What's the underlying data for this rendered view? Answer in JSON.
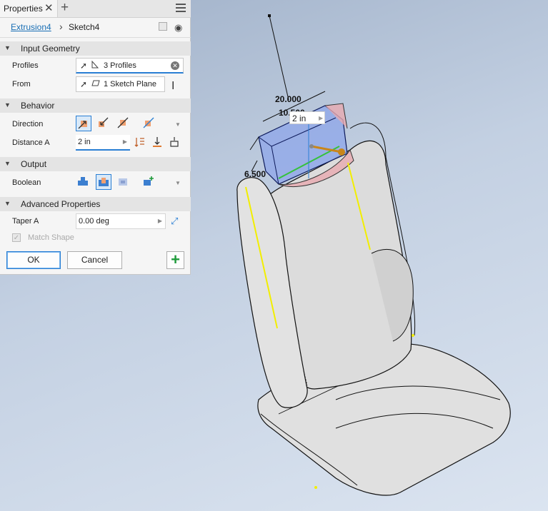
{
  "panel": {
    "tab_label": "Properties",
    "tab_close": "✕",
    "tab_add": "+",
    "breadcrumb": {
      "parent": "Extrusion4",
      "separator": "›",
      "current": "Sketch4"
    },
    "sections": {
      "input_geometry": "Input Geometry",
      "behavior": "Behavior",
      "output": "Output",
      "advanced": "Advanced Properties"
    },
    "rows": {
      "profiles_label": "Profiles",
      "profiles_value": "3 Profiles",
      "from_label": "From",
      "from_value": "1 Sketch Plane",
      "direction_label": "Direction",
      "distance_label": "Distance A",
      "distance_value": "2 in",
      "boolean_label": "Boolean",
      "taper_label": "Taper A",
      "taper_value": "0.00 deg",
      "match_shape_label": "Match Shape",
      "match_shape_checked": true
    },
    "buttons": {
      "ok": "OK",
      "cancel": "Cancel",
      "apply": "+"
    },
    "colors": {
      "accent": "#2a7fd4",
      "link": "#1a6fb5",
      "apply_green": "#1e9a3a"
    },
    "icons": [
      "select-cursor-icon",
      "profile-icon",
      "sketch-plane-icon",
      "ibeam-icon",
      "direction-default-icon",
      "direction-flipped-icon",
      "direction-symmetric-icon",
      "direction-asymmetric-icon",
      "distance-measure-icon",
      "distance-to-icon",
      "distance-between-icon",
      "join-icon",
      "cut-icon",
      "intersect-icon",
      "new-solid-icon",
      "taper-flip-icon",
      "eye-icon"
    ]
  },
  "viewport": {
    "dimensions": {
      "d1": "20.000",
      "d2": "10.500",
      "d3": "6.500"
    },
    "hud_distance": "2 in",
    "colors": {
      "preview_blue": "#7e98e3",
      "preview_pink": "#e9aab0",
      "seat_grey": "#d9d9d9",
      "edge_yellow": "#f2ee00",
      "arrow_orange": "#c9861a"
    }
  }
}
